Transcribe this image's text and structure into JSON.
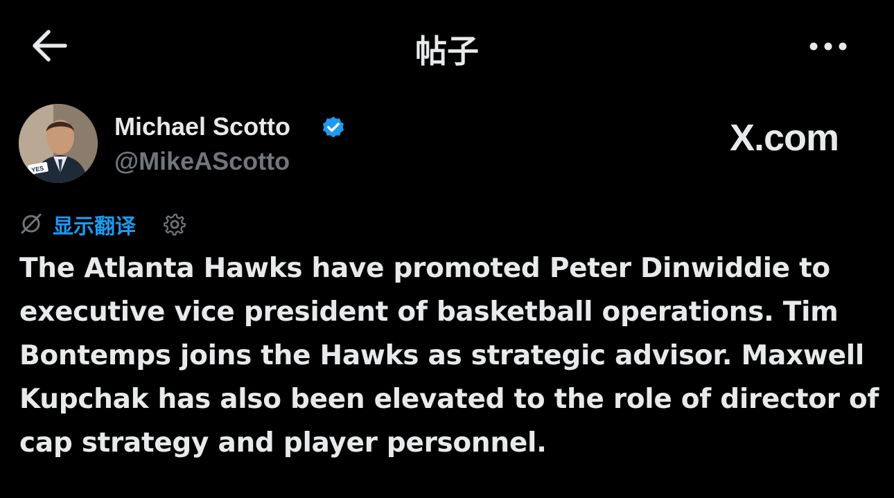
{
  "header": {
    "title": "帖子",
    "back_icon": "arrow-left-icon",
    "more_icon": "more-horizontal-icon"
  },
  "author": {
    "display_name": "Michael Scotto",
    "handle": "@MikeAScotto",
    "verified_icon": "verified-badge-icon",
    "avatar_badge_text": "YES"
  },
  "watermark": {
    "text": "X.com"
  },
  "translate": {
    "label": "显示翻译",
    "icon": "translate-off-icon",
    "settings_icon": "gear-icon"
  },
  "post": {
    "lines": [
      "The Atlanta Hawks have promoted Peter Dinwiddie to",
      "executive vice president of basketball operations. Tim",
      "Bontemps joins the Hawks as strategic advisor. Maxwell",
      "Kupchak has also been elevated to the role of director of",
      "cap strategy and player personnel."
    ]
  },
  "colors": {
    "background": "#000000",
    "text": "#e7e9ea",
    "secondary": "#71767b",
    "accent": "#1d9bf0"
  }
}
